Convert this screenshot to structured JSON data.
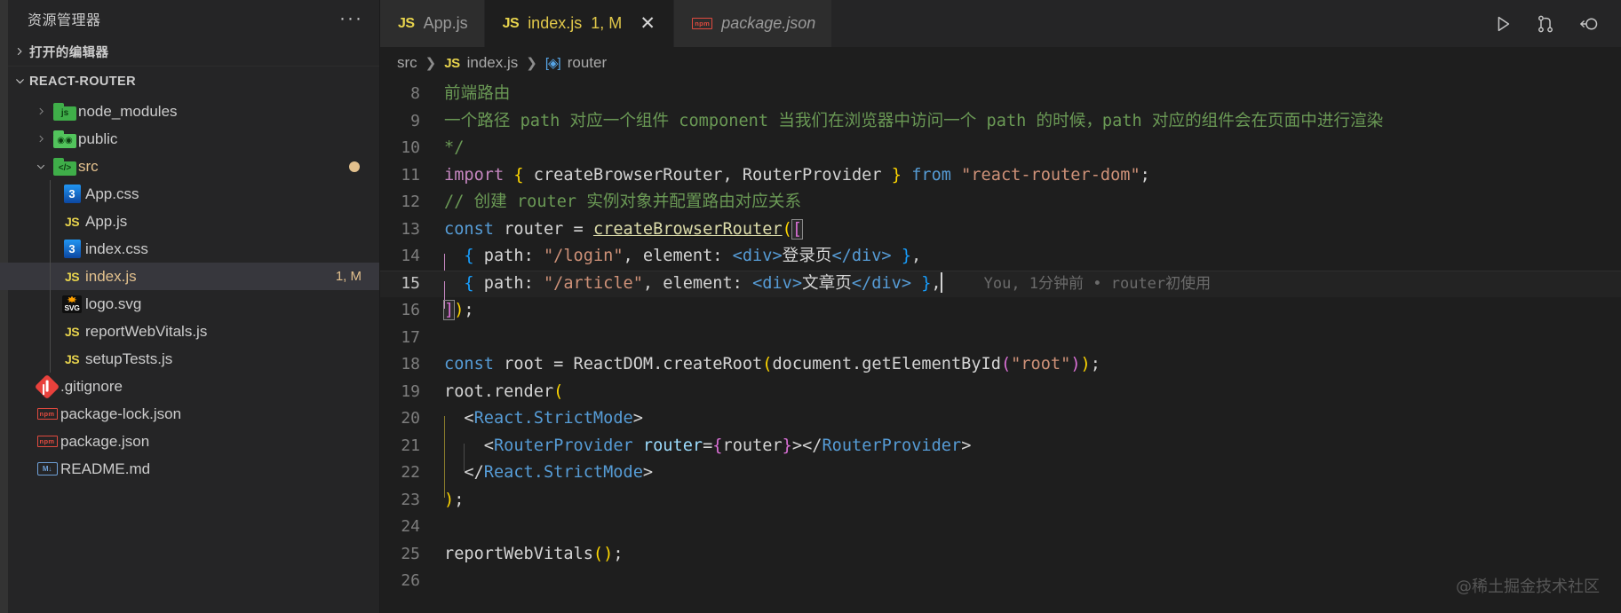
{
  "sidebar": {
    "title": "资源管理器",
    "more_actions": "···",
    "sections": [
      {
        "label": "打开的编辑器",
        "expanded": false
      },
      {
        "label": "REACT-ROUTER",
        "expanded": true
      }
    ],
    "tree": [
      {
        "name": "node_modules",
        "icon": "folder-node-icon",
        "type": "folder",
        "depth": 1,
        "expanded": false,
        "badge": ""
      },
      {
        "name": "public",
        "icon": "folder-public-icon",
        "type": "folder",
        "depth": 1,
        "expanded": false,
        "badge": ""
      },
      {
        "name": "src",
        "icon": "folder-src-icon",
        "type": "folder",
        "depth": 1,
        "expanded": true,
        "badge": "•",
        "modified": true
      },
      {
        "name": "App.css",
        "icon": "css-file-icon",
        "type": "file",
        "depth": 2,
        "badge": ""
      },
      {
        "name": "App.js",
        "icon": "js-file-icon",
        "type": "file",
        "depth": 2,
        "badge": ""
      },
      {
        "name": "index.css",
        "icon": "css-file-icon",
        "type": "file",
        "depth": 2,
        "badge": ""
      },
      {
        "name": "index.js",
        "icon": "js-file-icon",
        "type": "file",
        "depth": 2,
        "badge": "1, M",
        "selected": true,
        "modified": true
      },
      {
        "name": "logo.svg",
        "icon": "svg-file-icon",
        "type": "file",
        "depth": 2,
        "badge": ""
      },
      {
        "name": "reportWebVitals.js",
        "icon": "js-file-icon",
        "type": "file",
        "depth": 2,
        "badge": ""
      },
      {
        "name": "setupTests.js",
        "icon": "js-file-icon",
        "type": "file",
        "depth": 2,
        "badge": ""
      },
      {
        "name": ".gitignore",
        "icon": "git-file-icon",
        "type": "file",
        "depth": 1,
        "badge": ""
      },
      {
        "name": "package-lock.json",
        "icon": "npm-file-icon",
        "type": "file",
        "depth": 1,
        "badge": ""
      },
      {
        "name": "package.json",
        "icon": "npm-file-icon",
        "type": "file",
        "depth": 1,
        "badge": ""
      },
      {
        "name": "README.md",
        "icon": "markdown-file-icon",
        "type": "file",
        "depth": 1,
        "badge": ""
      }
    ]
  },
  "tabs": [
    {
      "label": "App.js",
      "icon": "js-file-icon",
      "active": false,
      "preview": false,
      "badge": "",
      "closable": false
    },
    {
      "label": "index.js",
      "icon": "js-file-icon",
      "active": true,
      "preview": false,
      "badge": "1, M",
      "closable": true,
      "close_glyph": "✕"
    },
    {
      "label": "package.json",
      "icon": "npm-file-icon",
      "active": false,
      "preview": true,
      "badge": "",
      "closable": false
    }
  ],
  "editor_actions": [
    {
      "name": "run-button",
      "glyph": "run"
    },
    {
      "name": "split-editor-button",
      "glyph": "fork"
    },
    {
      "name": "open-changes-button",
      "glyph": "back-circle"
    }
  ],
  "breadcrumb": [
    {
      "label": "src",
      "icon": ""
    },
    {
      "label": "index.js",
      "icon": "js-file-icon"
    },
    {
      "label": "router",
      "icon": "symbol-object-icon"
    }
  ],
  "blame": {
    "text": "You, 1分钟前 • router初使用"
  },
  "watermark": "@稀土掘金技术社区",
  "code": {
    "first_line": 8,
    "lines": [
      {
        "n": 8,
        "text": "  前端路由"
      },
      {
        "n": 9,
        "text": "  一个路径 path 对应一个组件 component 当我们在浏览器中访问一个 path 的时候，path 对应的组件会在页面中进行渲染"
      },
      {
        "n": 10,
        "text": "  */"
      },
      {
        "n": 11,
        "text": "  import { createBrowserRouter, RouterProvider } from \"react-router-dom\";"
      },
      {
        "n": 12,
        "text": "  // 创建 router 实例对象并配置路由对应关系"
      },
      {
        "n": 13,
        "text": "  const router = createBrowserRouter(["
      },
      {
        "n": 14,
        "text": "    { path: \"/login\", element: <div>登录页</div> },"
      },
      {
        "n": 15,
        "text": "    { path: \"/article\", element: <div>文章页</div> },"
      },
      {
        "n": 16,
        "text": "  ]);"
      },
      {
        "n": 17,
        "text": ""
      },
      {
        "n": 18,
        "text": "  const root = ReactDOM.createRoot(document.getElementById(\"root\"));"
      },
      {
        "n": 19,
        "text": "  root.render("
      },
      {
        "n": 20,
        "text": "    <React.StrictMode>"
      },
      {
        "n": 21,
        "text": "      <RouterProvider router={router}></RouterProvider>"
      },
      {
        "n": 22,
        "text": "    </React.StrictMode>"
      },
      {
        "n": 23,
        "text": "  );"
      },
      {
        "n": 24,
        "text": ""
      },
      {
        "n": 25,
        "text": "  reportWebVitals();"
      },
      {
        "n": 26,
        "text": ""
      }
    ],
    "tokens": {
      "l8": [
        {
          "t": "前端路由",
          "c": "t-comment"
        }
      ],
      "l9": [
        {
          "t": "一个路径 path 对应一个组件 component 当我们在浏览器中访问一个 path 的时候，path 对应的组件会在页面中进行渲染",
          "c": "t-comment"
        }
      ],
      "l10": [
        {
          "t": "*/",
          "c": "t-comment"
        }
      ],
      "l11": [
        {
          "t": "import",
          "c": "t-kw-ctrl"
        },
        {
          "t": " ",
          "c": "t-plain"
        },
        {
          "t": "{",
          "c": "t-brace-y"
        },
        {
          "t": " createBrowserRouter, RouterProvider ",
          "c": "t-plain"
        },
        {
          "t": "}",
          "c": "t-brace-y"
        },
        {
          "t": " ",
          "c": "t-plain"
        },
        {
          "t": "from",
          "c": "t-key"
        },
        {
          "t": " ",
          "c": "t-plain"
        },
        {
          "t": "\"react-router-dom\"",
          "c": "t-str"
        },
        {
          "t": ";",
          "c": "t-plain"
        }
      ],
      "l12": [
        {
          "t": "// 创建 router 实例对象并配置路由对应关系",
          "c": "t-comment"
        }
      ],
      "l13": [
        {
          "t": "const",
          "c": "t-key"
        },
        {
          "t": " ",
          "c": "t-plain"
        },
        {
          "t": "router",
          "c": "t-plain"
        },
        {
          "t": " = ",
          "c": "t-plain"
        },
        {
          "t": "createBrowserRouter",
          "c": "underline-fn"
        },
        {
          "t": "(",
          "c": "t-brace-y"
        },
        {
          "t": "[",
          "c": "t-brace-p"
        }
      ],
      "l14": [
        {
          "t": "{",
          "c": "t-brace-b"
        },
        {
          "t": " path: ",
          "c": "t-plain"
        },
        {
          "t": "\"/login\"",
          "c": "t-str"
        },
        {
          "t": ", element: ",
          "c": "t-plain"
        },
        {
          "t": "<div>",
          "c": "t-tag"
        },
        {
          "t": "登录页",
          "c": "t-plain"
        },
        {
          "t": "</div>",
          "c": "t-tag"
        },
        {
          "t": " ",
          "c": "t-plain"
        },
        {
          "t": "}",
          "c": "t-brace-b"
        },
        {
          "t": ",",
          "c": "t-plain"
        }
      ],
      "l15": [
        {
          "t": "{",
          "c": "t-brace-b"
        },
        {
          "t": " path: ",
          "c": "t-plain"
        },
        {
          "t": "\"/article\"",
          "c": "t-str"
        },
        {
          "t": ", element: ",
          "c": "t-plain"
        },
        {
          "t": "<div>",
          "c": "t-tag"
        },
        {
          "t": "文章页",
          "c": "t-plain"
        },
        {
          "t": "</div>",
          "c": "t-tag"
        },
        {
          "t": " ",
          "c": "t-plain"
        },
        {
          "t": "}",
          "c": "t-brace-b"
        },
        {
          "t": ",",
          "c": "t-plain"
        }
      ],
      "l16": [
        {
          "t": "]",
          "c": "t-brace-p"
        },
        {
          "t": ")",
          "c": "t-brace-y"
        },
        {
          "t": ";",
          "c": "t-plain"
        }
      ],
      "l18": [
        {
          "t": "const",
          "c": "t-key"
        },
        {
          "t": " root = ",
          "c": "t-plain"
        },
        {
          "t": "ReactDOM",
          "c": "t-plain"
        },
        {
          "t": ".createRoot",
          "c": "t-plain"
        },
        {
          "t": "(",
          "c": "t-brace-y"
        },
        {
          "t": "document",
          "c": "t-plain"
        },
        {
          "t": ".getElementById",
          "c": "t-plain"
        },
        {
          "t": "(",
          "c": "t-brace-p"
        },
        {
          "t": "\"root\"",
          "c": "t-str"
        },
        {
          "t": ")",
          "c": "t-brace-p"
        },
        {
          "t": ")",
          "c": "t-brace-y"
        },
        {
          "t": ";",
          "c": "t-plain"
        }
      ],
      "l19": [
        {
          "t": "root.render",
          "c": "t-plain"
        },
        {
          "t": "(",
          "c": "t-brace-y"
        }
      ],
      "l20": [
        {
          "t": "<",
          "c": "t-plain"
        },
        {
          "t": "React.StrictMode",
          "c": "t-tag"
        },
        {
          "t": ">",
          "c": "t-plain"
        }
      ],
      "l21": [
        {
          "t": "<",
          "c": "t-plain"
        },
        {
          "t": "RouterProvider",
          "c": "t-tag"
        },
        {
          "t": " ",
          "c": "t-plain"
        },
        {
          "t": "router",
          "c": "t-attr"
        },
        {
          "t": "=",
          "c": "t-plain"
        },
        {
          "t": "{",
          "c": "t-brace-p"
        },
        {
          "t": "router",
          "c": "t-plain"
        },
        {
          "t": "}",
          "c": "t-brace-p"
        },
        {
          "t": ">",
          "c": "t-plain"
        },
        {
          "t": "</",
          "c": "t-plain"
        },
        {
          "t": "RouterProvider",
          "c": "t-tag"
        },
        {
          "t": ">",
          "c": "t-plain"
        }
      ],
      "l22": [
        {
          "t": "</",
          "c": "t-plain"
        },
        {
          "t": "React.StrictMode",
          "c": "t-tag"
        },
        {
          "t": ">",
          "c": "t-plain"
        }
      ],
      "l23": [
        {
          "t": ")",
          "c": "t-brace-y"
        },
        {
          "t": ";",
          "c": "t-plain"
        }
      ],
      "l25": [
        {
          "t": "reportWebVitals",
          "c": "t-plain"
        },
        {
          "t": "(",
          "c": "t-brace-y"
        },
        {
          "t": ")",
          "c": "t-brace-y"
        },
        {
          "t": ";",
          "c": "t-plain"
        }
      ]
    }
  },
  "colors": {
    "editor_bg": "#1e1e1e",
    "sidebar_bg": "#252526",
    "tab_inactive_bg": "#2d2d2d",
    "selection_bg": "#37373d",
    "modified_accent": "#e2c08d",
    "js_yellow": "#e8d44d"
  }
}
